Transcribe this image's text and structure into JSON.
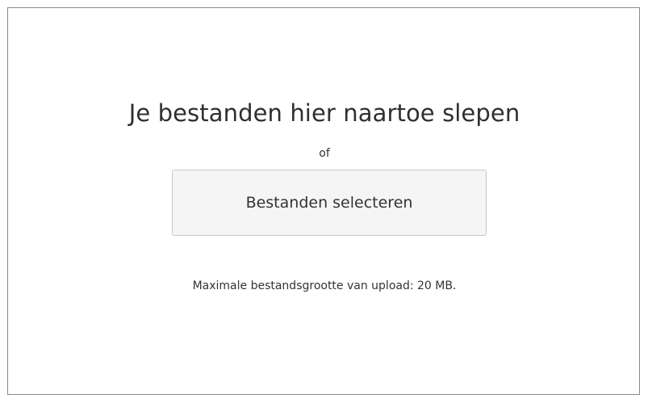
{
  "dropzone": {
    "title": "Je bestanden hier naartoe slepen",
    "or_text": "of",
    "select_button_label": "Bestanden selecteren",
    "max_size_text": "Maximale bestandsgrootte van upload: 20 MB."
  },
  "colors": {
    "border": "#8a8a8a",
    "button_bg": "#f5f5f5",
    "button_border": "#c8c8c8",
    "text": "#333333"
  }
}
